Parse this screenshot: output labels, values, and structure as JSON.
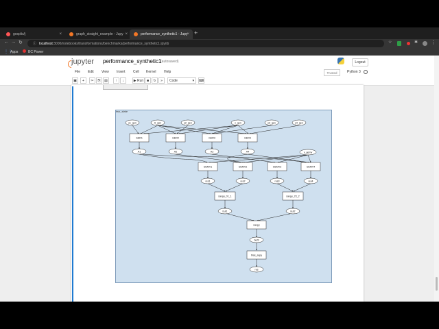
{
  "browser": {
    "tabs": [
      {
        "title": "gosplis/j",
        "favicon_color": "#ff5555"
      },
      {
        "title": "graph_straight_example - Jupy",
        "favicon_color": "#f37726"
      },
      {
        "title": "performance_synthetic1 - Jupy",
        "favicon_color": "#f37726",
        "active": true
      }
    ],
    "new_tab": "+",
    "url_host": "localhost",
    "url_path": ":3000/notebooks/transformations/benchmarks/performance_synthetic1.ipynb",
    "bookmarks": [
      "Apps",
      "BC Power"
    ]
  },
  "jupyter": {
    "logo_text": "jupyter",
    "notebook_name": "performance_synthetic1",
    "autosave": "(autosaved)",
    "logout_label": "Logout",
    "menu": [
      "File",
      "Edit",
      "View",
      "Insert",
      "Cell",
      "Kernel",
      "Help"
    ],
    "trusted": "Trusted",
    "kernel_name": "Python 3",
    "toolbar": {
      "run_label": "▶ Run",
      "cell_type": "Code"
    }
  },
  "graph": {
    "label": "two_state",
    "nodes": {
      "y1_gen": "y1_gen",
      "A_gen": "A_gen",
      "y2_gen": "y2_gen",
      "x_gen": "x_gen",
      "y3_gen": "y3_gen",
      "y4_gen": "y4_gen",
      "GER1": "GER1",
      "GER2": "GER2",
      "GER3": "GER3",
      "GER4": "GER4",
      "A1": "A1",
      "A2": "A2",
      "A3": "A3",
      "A4": "A4",
      "x_gemv": "x_gemv",
      "GEMV1": "GEMV1",
      "GEMV2": "GEMV2",
      "GEMV3": "GEMV3",
      "GEMV4": "GEMV4",
      "res1": "res1",
      "res2": "res2",
      "res3": "res3",
      "res4": "res4",
      "saxpy01": "saxpy_01_1",
      "saxpy23": "saxpy_23_2",
      "buf1": "buf1",
      "buf2": "buf2",
      "saxpy": "saxpy",
      "buf3": "buf3",
      "blas_axpy": "blas_axpy",
      "res": "res"
    }
  }
}
